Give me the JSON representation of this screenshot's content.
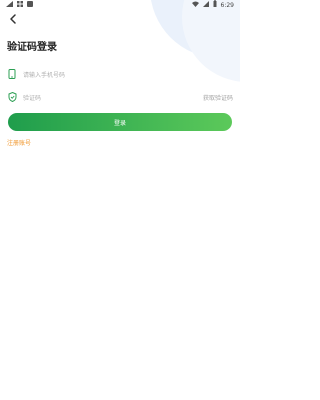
{
  "status_bar": {
    "left_icons": [
      "signal-icon",
      "grid-icon",
      "app-icon"
    ],
    "time": "6:29",
    "right_icons": [
      "wifi-icon",
      "cellular-icon",
      "battery-icon"
    ]
  },
  "header": {
    "back_icon": "chevron-left-icon"
  },
  "page": {
    "title": "验证码登录"
  },
  "form": {
    "phone": {
      "placeholder": "请输入手机号码",
      "icon": "phone-icon"
    },
    "code": {
      "placeholder": "验证码",
      "icon": "shield-icon",
      "get_code_label": "获取验证码"
    },
    "login_label": "登录",
    "register_label": "注册账号"
  },
  "colors": {
    "accent_start": "#1f9d4c",
    "accent_end": "#5cc95a",
    "link": "#f0962b",
    "background_decor": "#eaf1fb"
  }
}
